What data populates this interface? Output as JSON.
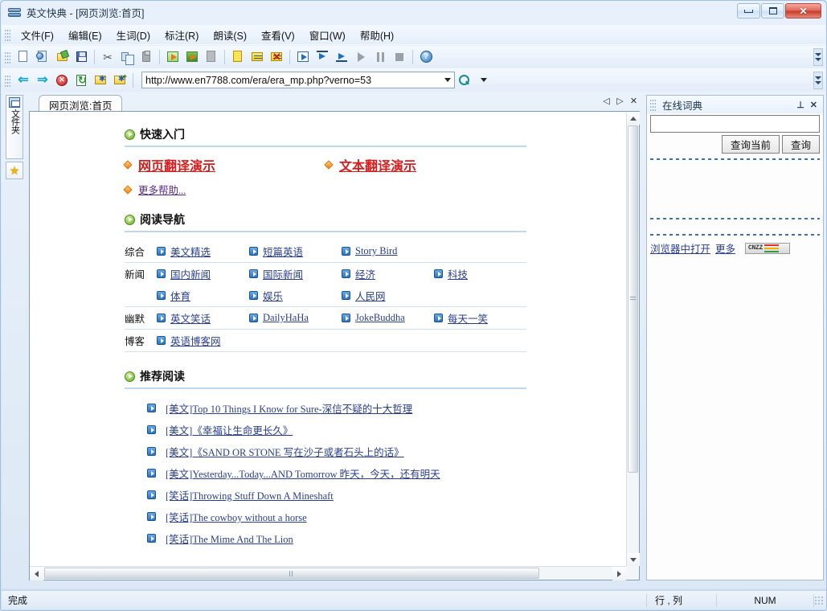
{
  "window": {
    "title": "英文快典 - [网页浏览:首页]",
    "app_icon": "books-icon",
    "buttons": {
      "minimize": "minimize-icon",
      "maximize": "maximize-icon",
      "close": "✕"
    }
  },
  "menu": {
    "items": [
      {
        "label": "文件(F)",
        "name": "menu-file"
      },
      {
        "label": "编辑(E)",
        "name": "menu-edit"
      },
      {
        "label": "生词(D)",
        "name": "menu-newwords"
      },
      {
        "label": "标注(R)",
        "name": "menu-annotate"
      },
      {
        "label": "朗读(S)",
        "name": "menu-read-aloud"
      },
      {
        "label": "查看(V)",
        "name": "menu-view"
      },
      {
        "label": "窗口(W)",
        "name": "menu-window"
      },
      {
        "label": "帮助(H)",
        "name": "menu-help"
      }
    ]
  },
  "address_bar": {
    "url": "http://www.en7788.com/era/era_mp.php?verno=53",
    "placeholder": ""
  },
  "tabs": {
    "document_tab": "网页浏览:首页",
    "prev": "◁",
    "next": "▷",
    "close": "✕"
  },
  "left_dock": {
    "folder_label": "文件夹",
    "star": "★"
  },
  "page": {
    "sections": [
      {
        "title": "快速入门",
        "name": "section-quick-start"
      },
      {
        "title": "阅读导航",
        "name": "section-reading-nav"
      },
      {
        "title": "推荐阅读",
        "name": "section-recommended"
      }
    ],
    "quick_start": {
      "primary_links": [
        "网页翻译演示",
        "文本翻译演示"
      ],
      "more_help": "更多帮助..."
    },
    "nav_rows": [
      {
        "category": "综合",
        "links": [
          "美文精选",
          "短篇英语",
          "Story Bird"
        ]
      },
      {
        "category": "新闻",
        "links": [
          "国内新闻",
          "国际新闻",
          "经济",
          "科技"
        ]
      },
      {
        "category": "",
        "links": [
          "体育",
          "娱乐",
          "人民网"
        ]
      },
      {
        "category": "幽默",
        "links": [
          "英文笑话",
          "DailyHaHa",
          "JokeBuddha",
          "每天一笑"
        ]
      },
      {
        "category": "博客",
        "links": [
          "英语博客网"
        ]
      }
    ],
    "articles": [
      "[美文]Top 10 Things I Know for Sure-深信不疑的十大哲理",
      "[美文]《幸福让生命更长久》",
      "[美文]《SAND OR STONE 写在沙子或者石头上的话》",
      "[美文]Yesterday...Today...AND Tomorrow 昨天，今天，还有明天",
      "[笑话]Throwing Stuff Down A Mineshaft",
      "[笑话]The cowboy without a horse",
      "[笑话]The Mime And The Lion"
    ]
  },
  "dictionary": {
    "title": "在线词典",
    "pin": "⊥",
    "close": "✕",
    "input_value": "",
    "input_placeholder": "",
    "buttons": [
      "查询当前",
      "查询"
    ],
    "links": [
      "浏览器中打开",
      "更多"
    ],
    "badge_text": "CNZZ"
  },
  "status_bar": {
    "message": "完成",
    "rowcol": "行 , 列",
    "num": "NUM"
  },
  "colors": {
    "accent_red": "#d81b1b",
    "link_blue": "#2a3f8f",
    "bullet_green": "#66b022",
    "rule_blue": "#bcd8ef"
  }
}
